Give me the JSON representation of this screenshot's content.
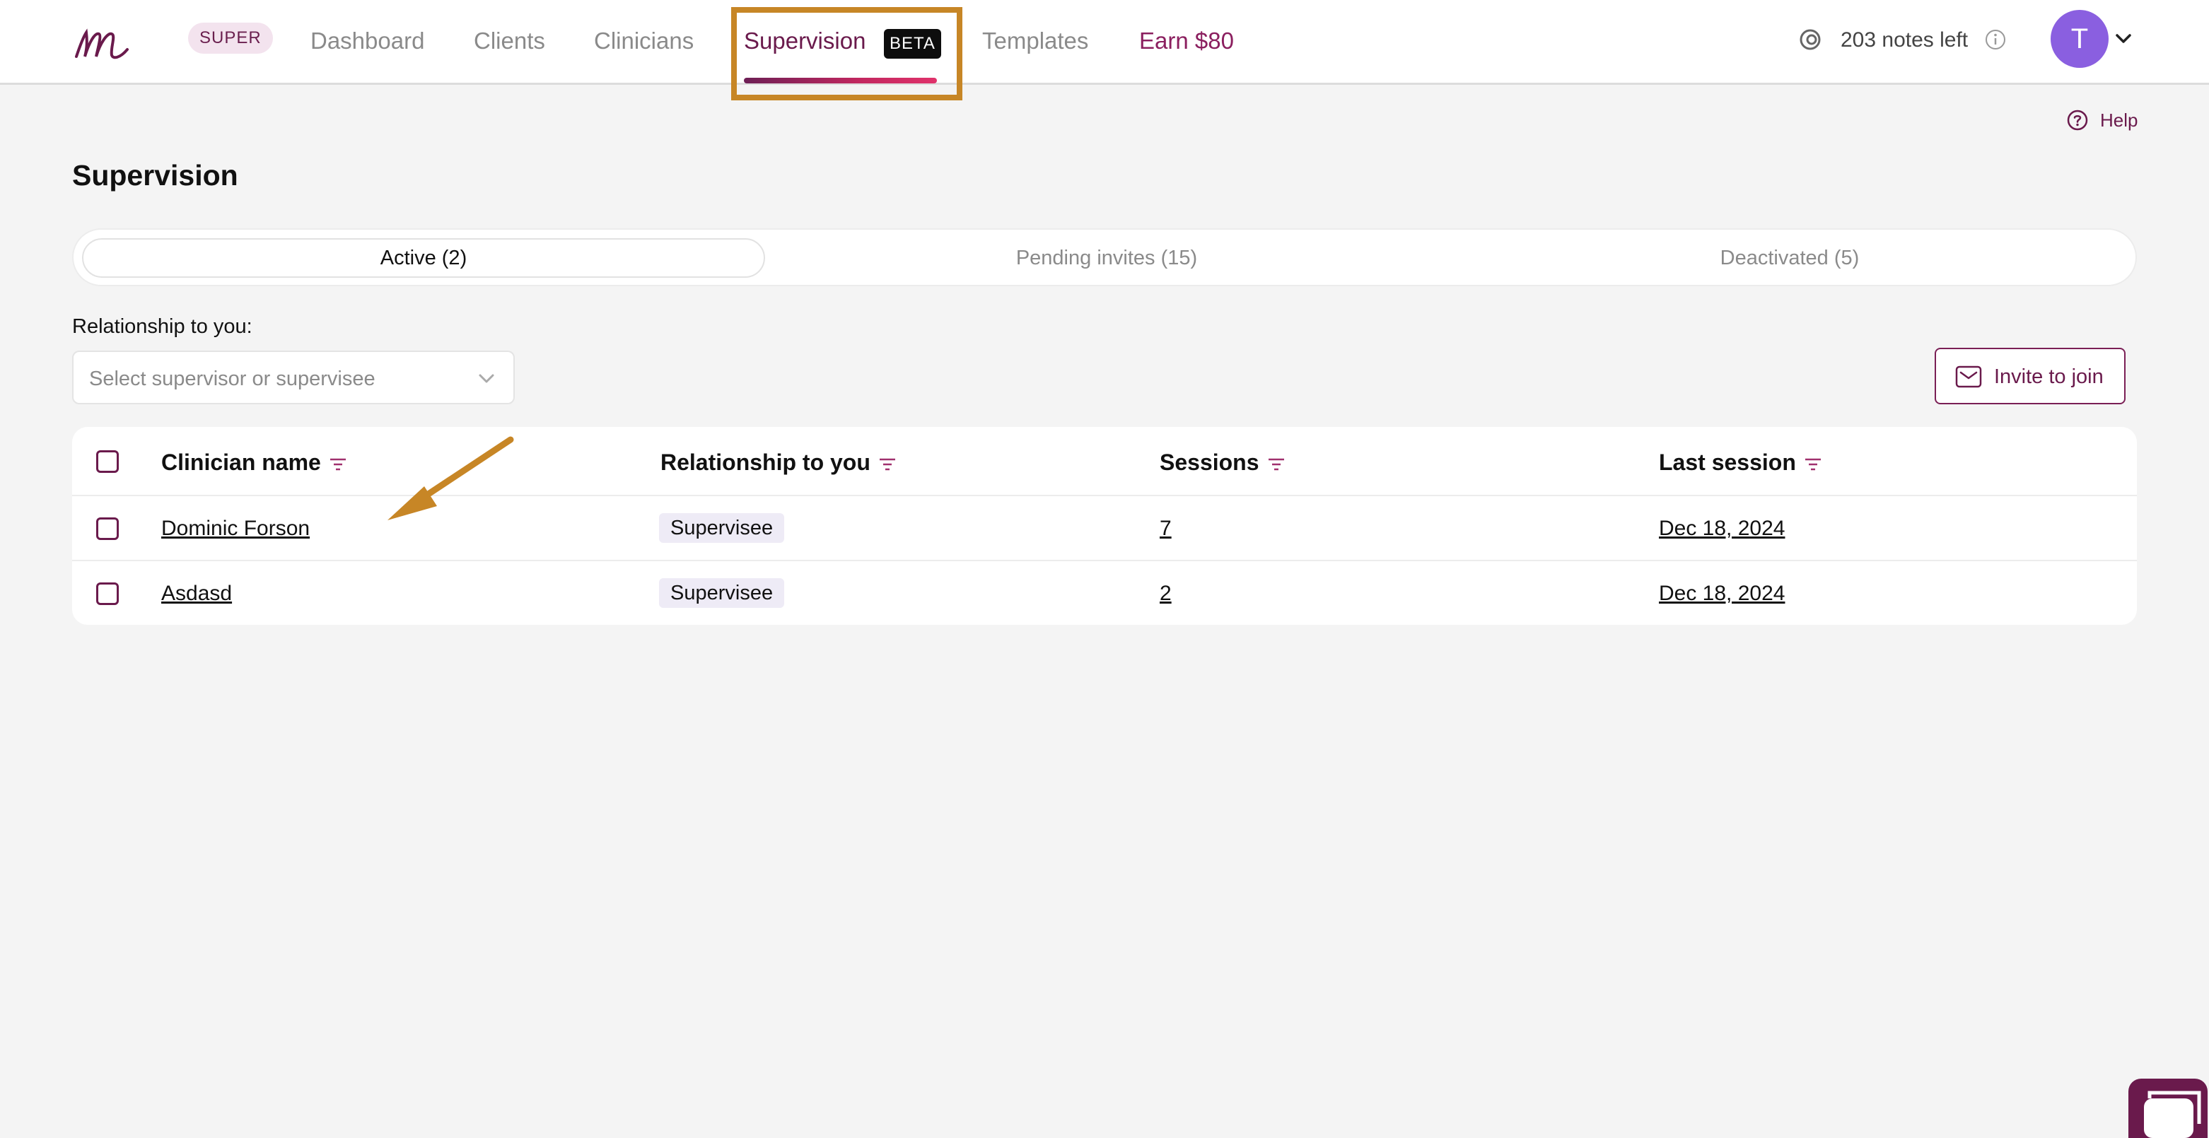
{
  "header": {
    "logo_alt": "m",
    "super_badge": "SUPER",
    "nav": {
      "dashboard": "Dashboard",
      "clients": "Clients",
      "clinicians": "Clinicians",
      "supervision": "Supervision",
      "beta": "BETA",
      "templates": "Templates",
      "earn": "Earn $80"
    },
    "notes_left": "203 notes left",
    "avatar_initial": "T"
  },
  "help": "Help",
  "page_title": "Supervision",
  "tabs": [
    {
      "label": "Active (2)",
      "active": true
    },
    {
      "label": "Pending invites (15)",
      "active": false
    },
    {
      "label": "Deactivated (5)",
      "active": false
    }
  ],
  "filter": {
    "label": "Relationship to you:",
    "placeholder": "Select supervisor or supervisee"
  },
  "invite_button": "Invite to join",
  "table": {
    "columns": [
      "Clinician name",
      "Relationship to you",
      "Sessions",
      "Last session"
    ],
    "rows": [
      {
        "name": "Dominic Forson",
        "relationship": "Supervisee",
        "sessions": "7",
        "last_session": "Dec 18, 2024"
      },
      {
        "name": "Asdasd",
        "relationship": "Supervisee",
        "sessions": "2",
        "last_session": "Dec 18, 2024"
      }
    ]
  },
  "colors": {
    "brand": "#6a1a4c",
    "annotation": "#c78626",
    "avatar": "#8a5fe0"
  },
  "icons": [
    "logo-icon",
    "notes-icon",
    "info-icon",
    "chevron-down-icon",
    "help-icon",
    "mail-icon",
    "filter-icon",
    "chat-icon"
  ]
}
